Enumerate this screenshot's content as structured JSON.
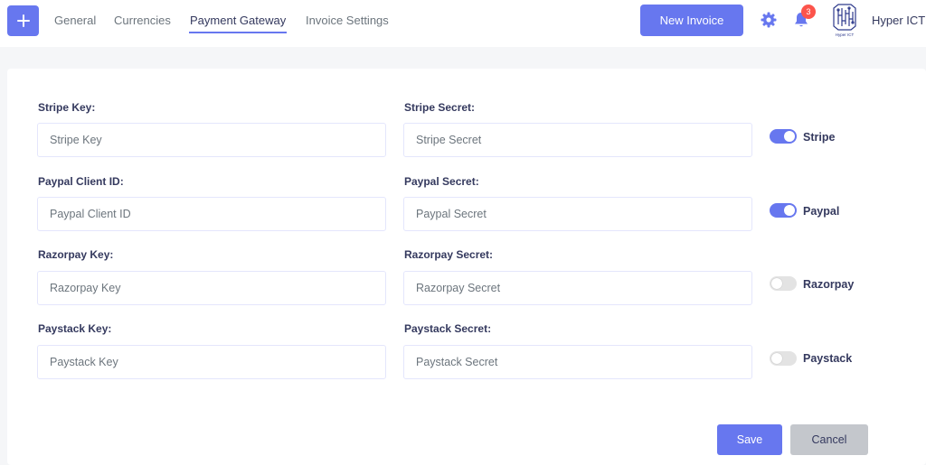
{
  "nav": {
    "tabs": [
      {
        "label": "General"
      },
      {
        "label": "Currencies"
      },
      {
        "label": "Payment Gateway"
      },
      {
        "label": "Invoice Settings"
      }
    ],
    "active_tab": "Payment Gateway",
    "new_invoice_label": "New Invoice",
    "notification_count": "3",
    "user_name": "Hyper ICT",
    "logo_text": "Hyper ICT",
    "icons": {
      "add": "plus-icon",
      "settings": "gear-icon",
      "notifications": "bell-icon"
    }
  },
  "form": {
    "stripe": {
      "key_label": "Stripe Key:",
      "key_placeholder": "Stripe Key",
      "secret_label": "Stripe Secret:",
      "secret_placeholder": "Stripe Secret",
      "toggle_label": "Stripe",
      "enabled": true
    },
    "paypal": {
      "key_label": "Paypal Client ID:",
      "key_placeholder": "Paypal Client ID",
      "secret_label": "Paypal Secret:",
      "secret_placeholder": "Paypal Secret",
      "toggle_label": "Paypal",
      "enabled": true
    },
    "razorpay": {
      "key_label": "Razorpay Key:",
      "key_placeholder": "Razorpay Key",
      "secret_label": "Razorpay Secret:",
      "secret_placeholder": "Razorpay Secret",
      "toggle_label": "Razorpay",
      "enabled": false
    },
    "paystack": {
      "key_label": "Paystack Key:",
      "key_placeholder": "Paystack Key",
      "secret_label": "Paystack Secret:",
      "secret_placeholder": "Paystack Secret",
      "toggle_label": "Paystack",
      "enabled": false
    },
    "save_label": "Save",
    "cancel_label": "Cancel"
  },
  "colors": {
    "accent": "#6777ef",
    "toggle_off": "#e3e3e3",
    "cancel_bg": "#c4c7cc",
    "badge": "#fc544b"
  }
}
